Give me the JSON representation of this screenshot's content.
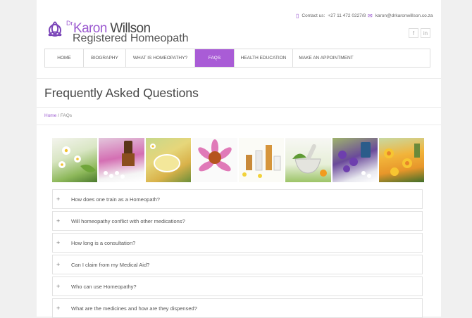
{
  "site": {
    "logo_dr": "Dr.",
    "logo_first": "Karon",
    "logo_last": "Willson",
    "logo_sub": "Registered Homeopath"
  },
  "contact": {
    "phone_label": "Contact us:",
    "phone": "+27 11 472 0227/8",
    "email": "karon@drkaronwillson.co.za"
  },
  "social": {
    "facebook": "f",
    "linkedin": "in"
  },
  "nav": {
    "items": [
      {
        "label": "Home"
      },
      {
        "label": "Biography"
      },
      {
        "label": "What is Homeopathy?"
      },
      {
        "label": "FAQs"
      },
      {
        "label": "Health Education"
      },
      {
        "label": "Make an Appointment"
      }
    ],
    "active": "FAQs"
  },
  "page": {
    "title": "Frequently Asked Questions"
  },
  "breadcrumb": {
    "home": "Home",
    "sep": " / ",
    "current": "FAQs"
  },
  "faq": {
    "items": [
      {
        "q": "How does one train as a Homeopath?"
      },
      {
        "q": "Will homeopathy conflict with other medications?"
      },
      {
        "q": "How long is a consultation?"
      },
      {
        "q": "Can I claim from my Medical Aid?"
      },
      {
        "q": "Who can use Homeopathy?"
      },
      {
        "q": "What are the medicines and how are they dispensed?"
      }
    ],
    "toggle": "+"
  },
  "colors": {
    "accent": "#a95cd6"
  }
}
